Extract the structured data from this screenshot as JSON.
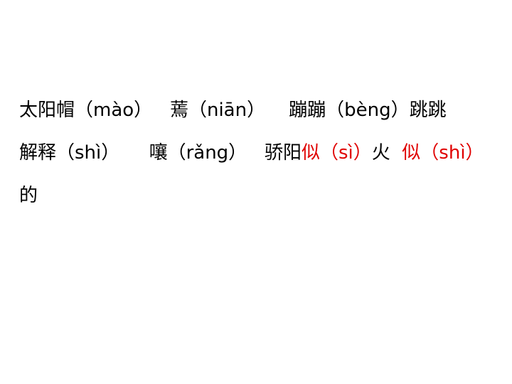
{
  "colors": {
    "text": "#000000",
    "highlight": "#e00000",
    "background": "#ffffff"
  },
  "paragraphs": [
    {
      "segments": [
        {
          "text": "太阳帽（mào）",
          "color": "#000000"
        },
        {
          "text": "   蔫（niān）",
          "color": "#000000"
        },
        {
          "text": "    蹦蹦（bèng）跳跳",
          "color": "#000000"
        }
      ]
    },
    {
      "segments": [
        {
          "text": "解释（shì）",
          "color": "#000000"
        },
        {
          "text": "     嚷（rǎng）",
          "color": "#000000"
        },
        {
          "text": "   骄阳",
          "color": "#000000"
        },
        {
          "text": "似（sì）",
          "color": "#e00000"
        },
        {
          "text": "火  ",
          "color": "#000000"
        },
        {
          "text": "似（shì）",
          "color": "#e00000"
        },
        {
          "text": "的",
          "color": "#000000"
        }
      ]
    }
  ]
}
